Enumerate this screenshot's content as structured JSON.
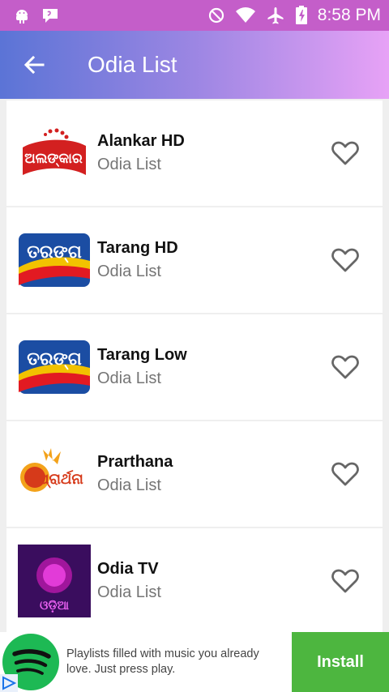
{
  "status_bar": {
    "time": "8:58 PM"
  },
  "app_bar": {
    "title": "Odia List"
  },
  "channels": [
    {
      "name": "Alankar HD",
      "category": "Odia List",
      "logo_text": "ଅଲଙ୍କାର"
    },
    {
      "name": "Tarang HD",
      "category": "Odia List",
      "logo_text": "ତରଙ୍ଗ"
    },
    {
      "name": "Tarang Low",
      "category": "Odia List",
      "logo_text": "ତରଙ୍ଗ"
    },
    {
      "name": "Prarthana",
      "category": "Odia List",
      "logo_text": "ପ୍ରାର୍ଥନା"
    },
    {
      "name": "Odia TV",
      "category": "Odia List",
      "logo_text": "ଓଡ଼ିଆ"
    }
  ],
  "ad": {
    "text": "Playlists filled with music you already love. Just press play.",
    "install_label": "Install"
  },
  "colors": {
    "status_bar": "#c45ec9",
    "app_bar_start": "#5b74d6",
    "app_bar_end": "#e7a2f6",
    "install": "#4db63f"
  }
}
